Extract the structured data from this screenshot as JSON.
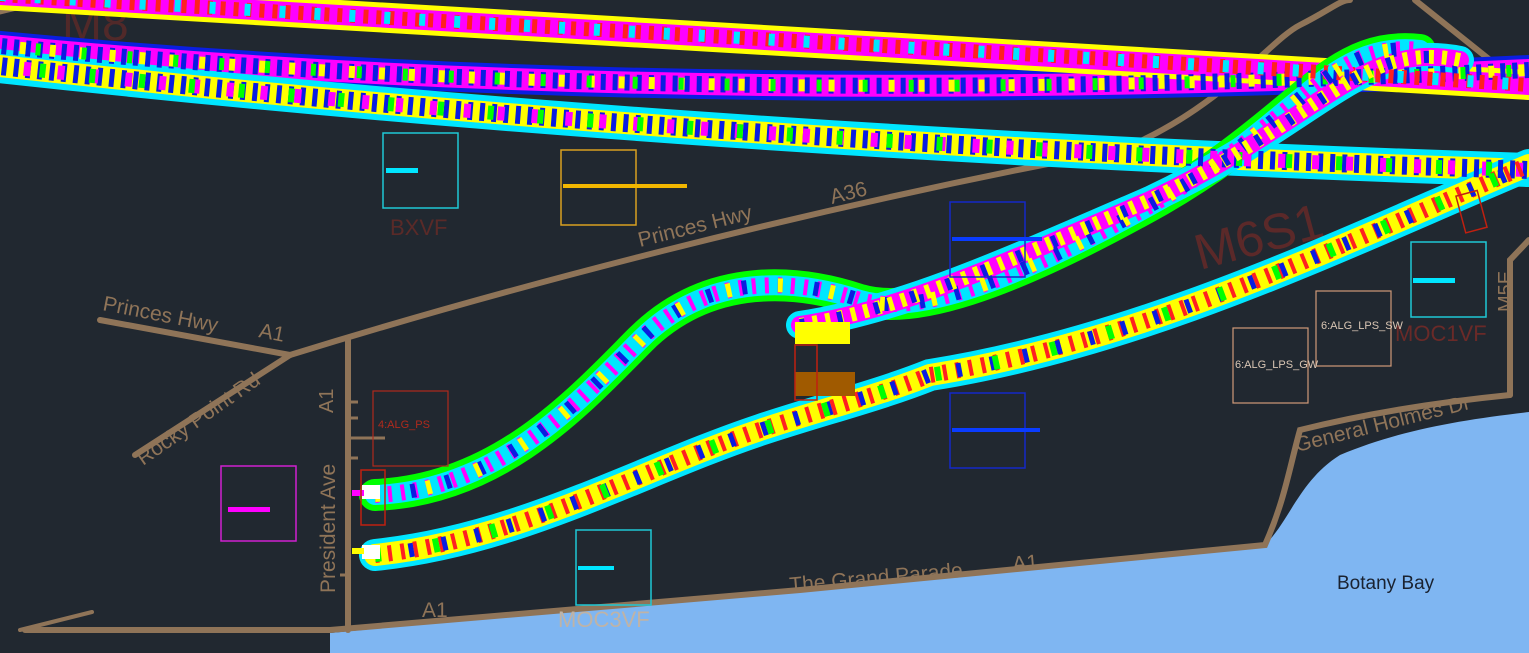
{
  "map": {
    "background_color": "#212830",
    "road_color": "#8f7458",
    "water_color": "#7fb6f2",
    "tunnel_palette": [
      "#ff00ff",
      "#ffff00",
      "#00ff00",
      "#00e6ff",
      "#0a1ee0",
      "#ff2020",
      "#ff8800",
      "#8800ff"
    ]
  },
  "labels": {
    "faded_M8": "M8",
    "faded_M6S1": "M6S1",
    "bxvf": "BXVF",
    "moc3vf": "MOC3VF",
    "moc1vf": "MOC1VF",
    "m5e": "M5E",
    "alg_ps": "4:ALG_PS",
    "alg_lps_sw": "6:ALG_LPS_SW",
    "alg_lps_gw": "6:ALG_LPS_GW",
    "botany_bay": "Botany Bay"
  },
  "roads": {
    "princes_hwy_upper": "Princes Hwy",
    "a36": "A36",
    "princes_hwy_left": "Princes Hwy",
    "a1_left": "A1",
    "rocky_point_rd": "Rocky Point Rd",
    "a1_vertical": "A1",
    "president_ave": "President Ave",
    "grand_parade": "The Grand Parade",
    "a1_parade": "A1",
    "a1_bottom": "A1",
    "general_holmes_dr": "General Holmes Dr"
  }
}
